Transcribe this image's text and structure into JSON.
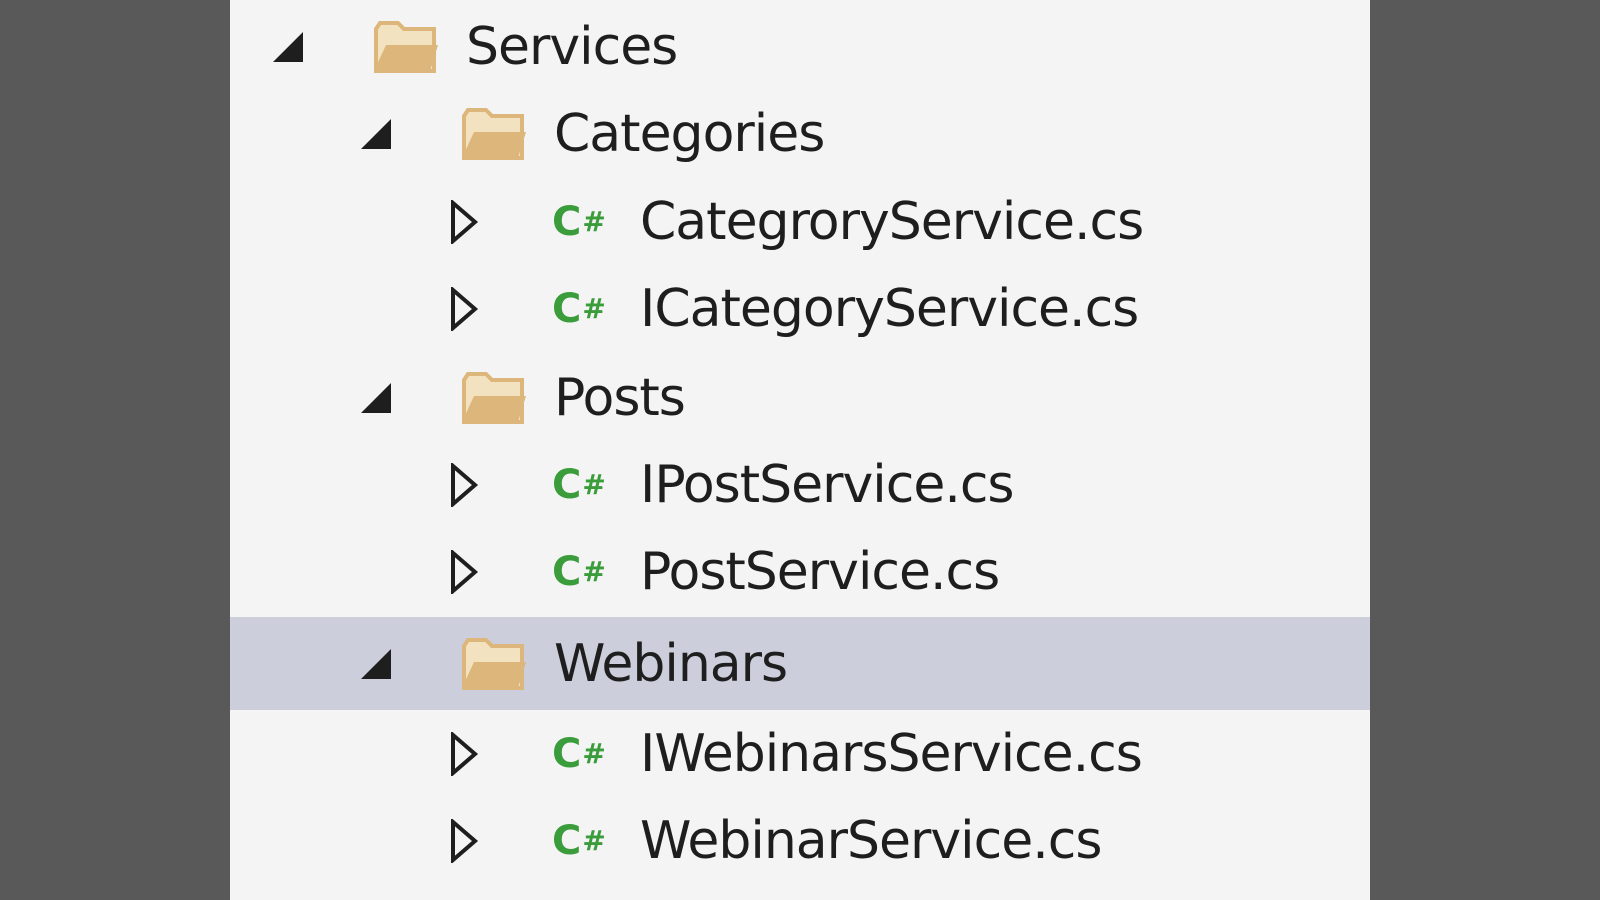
{
  "tree": {
    "services": {
      "label": "Services",
      "expander": "expanded",
      "icon": "folder-icon"
    },
    "categories": {
      "label": "Categories",
      "expander": "expanded",
      "icon": "folder-icon",
      "files": [
        {
          "label": "CategroryService.cs",
          "icon": "csharp-file-icon"
        },
        {
          "label": "ICategoryService.cs",
          "icon": "csharp-file-icon"
        }
      ]
    },
    "posts": {
      "label": "Posts",
      "expander": "expanded",
      "icon": "folder-icon",
      "files": [
        {
          "label": "IPostService.cs",
          "icon": "csharp-file-icon"
        },
        {
          "label": "PostService.cs",
          "icon": "csharp-file-icon"
        }
      ]
    },
    "webinars": {
      "label": "Webinars",
      "expander": "expanded",
      "icon": "folder-icon",
      "selected": true,
      "files": [
        {
          "label": "IWebinarsService.cs",
          "icon": "csharp-file-icon"
        },
        {
          "label": "WebinarService.cs",
          "icon": "csharp-file-icon"
        }
      ]
    }
  },
  "colors": {
    "background": "#595959",
    "panel": "#f4f4f4",
    "selection": "#cccedb",
    "csharp_green": "#3a9c3a",
    "folder": "#dcb67a"
  },
  "csharp_icon_text": {
    "letter": "C",
    "symbol": "#"
  }
}
